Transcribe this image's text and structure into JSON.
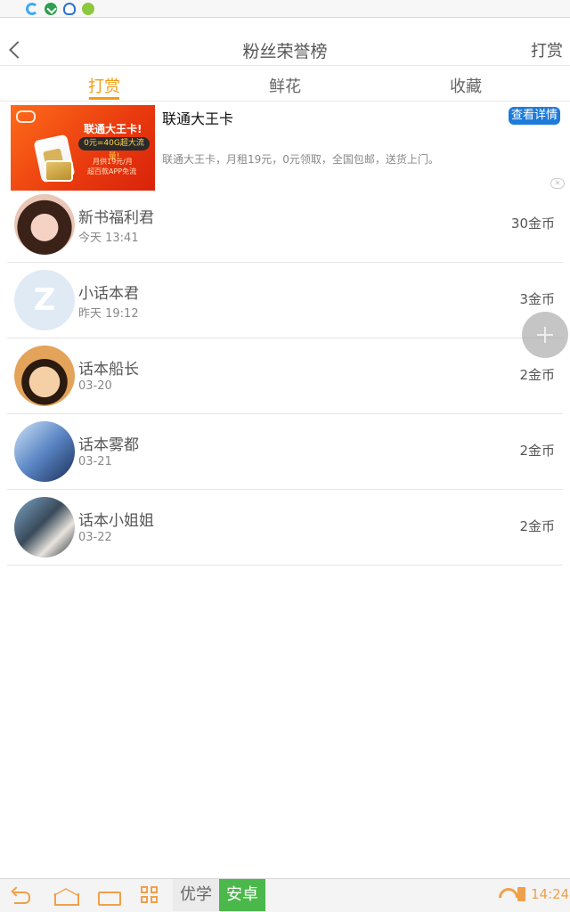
{
  "header": {
    "title": "粉丝荣誉榜",
    "right_action": "打赏"
  },
  "tabs": [
    {
      "label": "打赏",
      "active": true
    },
    {
      "label": "鲜花",
      "active": false
    },
    {
      "label": "收藏",
      "active": false
    }
  ],
  "ad": {
    "title": "联通大王卡",
    "button": "查看详情",
    "description": "联通大王卡，月租19元，0元领取，全国包邮，送货上门。",
    "image_headline": "联通大王卡!",
    "image_pill": "0元=40G超大流量!",
    "image_line1": "月供19元/月",
    "image_line2": "超百款APP免流",
    "close": "✕"
  },
  "leaderboard": [
    {
      "name": "新书福利君",
      "time": "今天 13:41",
      "coins": "30金币"
    },
    {
      "name": "小话本君",
      "time": "昨天 19:12",
      "coins": "3金币"
    },
    {
      "name": "话本船长",
      "time": "03-20",
      "coins": "2金币"
    },
    {
      "name": "话本雾都",
      "time": "03-21",
      "coins": "2金币"
    },
    {
      "name": "话本小姐姐",
      "time": "03-22",
      "coins": "2金币"
    }
  ],
  "navbar": {
    "brand_left": "优学",
    "brand_right": "安卓",
    "clock": "14:24"
  },
  "colors": {
    "accent": "#f39c12",
    "ad_button": "#1e7bd9",
    "brand_green": "#4ab84a"
  }
}
